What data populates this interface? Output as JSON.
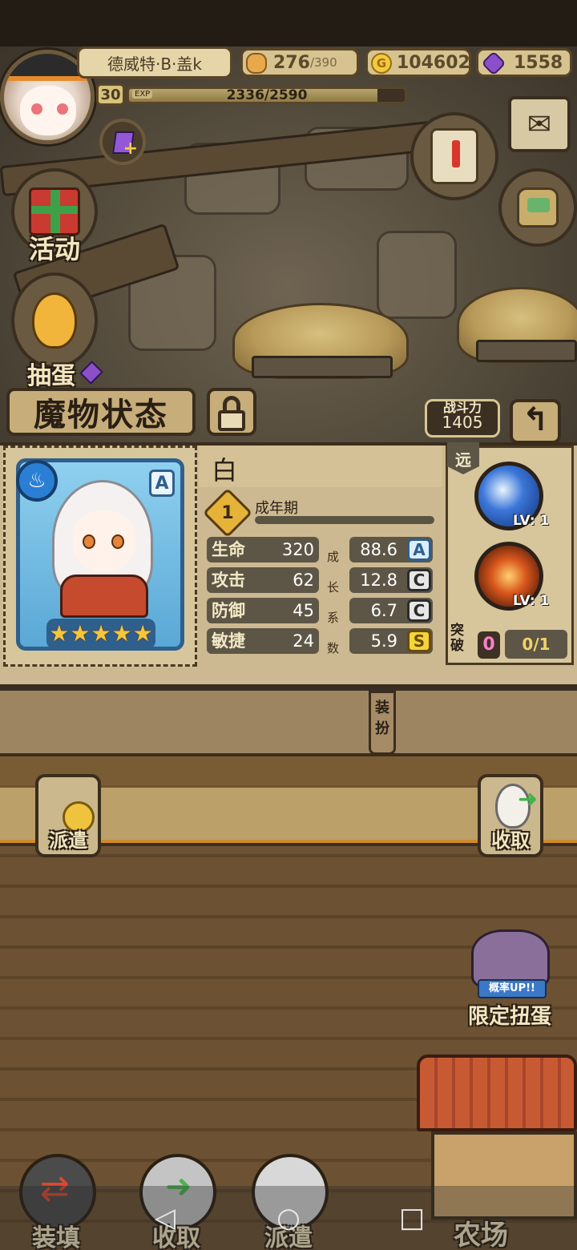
{
  "header": {
    "player_name": "德威特·B·盖k",
    "level": "30",
    "exp_tag": "EXP",
    "exp_text": "2336/2590",
    "exp_fraction": 0.902,
    "stamina_current": "276",
    "stamina_max": "/390",
    "gold": "104602",
    "gold_icon": "G",
    "gems": "1558"
  },
  "side_menu": {
    "event_label": "活动",
    "gacha_label": "抽蛋"
  },
  "status": {
    "title": "魔物状态",
    "power_label": "战斗力",
    "power_value": "1405",
    "back_icon": "↰"
  },
  "monster": {
    "name": "白",
    "rank": "A",
    "element_icon": "♨",
    "stars": 5,
    "stage_num": "1",
    "stage_label": "成年期",
    "stats": [
      {
        "name": "生命",
        "value": "320",
        "growth": "88.6",
        "grade": "A"
      },
      {
        "name": "攻击",
        "value": "62",
        "growth": "12.8",
        "grade": "C"
      },
      {
        "name": "防御",
        "value": "45",
        "growth": "6.7",
        "grade": "C"
      },
      {
        "name": "敏捷",
        "value": "24",
        "growth": "5.9",
        "grade": "S"
      }
    ],
    "growth_chars": [
      "成",
      "长",
      "系",
      "数"
    ],
    "range_tag": "远",
    "skills": [
      {
        "icon": "wave-skill-icon",
        "level": "LV: 1"
      },
      {
        "icon": "fire-sword-skill-icon",
        "level": "LV: 1"
      }
    ],
    "breakthrough_label": "突破",
    "breakthrough_badge": "0",
    "breakthrough_count": "0/1"
  },
  "lower": {
    "equip_tab": "装扮",
    "dispatch_label": "派遣",
    "collect_label": "收取",
    "limited_banner": "概率UP!!",
    "limited_label": "限定扭蛋",
    "farm_label": "农场"
  },
  "bottom_bar": {
    "load_label": "装填",
    "collect_label": "收取",
    "dispatch_label": "派遣"
  },
  "nav": {
    "back": "◁",
    "home": "○",
    "recent": "□"
  },
  "colors": {
    "panel_bg": "#cdb991",
    "stat_box": "#5d5646",
    "grade_a": "#2f5f8c",
    "grade_s": "#f3d43a",
    "breakthrough_badge": "#ff7ec8"
  }
}
